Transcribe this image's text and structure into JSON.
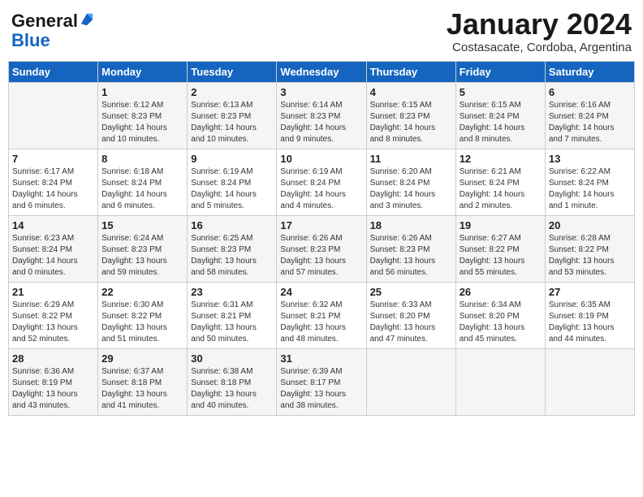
{
  "logo": {
    "general": "General",
    "blue": "Blue"
  },
  "title": "January 2024",
  "location": "Costasacate, Cordoba, Argentina",
  "days_header": [
    "Sunday",
    "Monday",
    "Tuesday",
    "Wednesday",
    "Thursday",
    "Friday",
    "Saturday"
  ],
  "weeks": [
    [
      {
        "day": "",
        "content": ""
      },
      {
        "day": "1",
        "content": "Sunrise: 6:12 AM\nSunset: 8:23 PM\nDaylight: 14 hours\nand 10 minutes."
      },
      {
        "day": "2",
        "content": "Sunrise: 6:13 AM\nSunset: 8:23 PM\nDaylight: 14 hours\nand 10 minutes."
      },
      {
        "day": "3",
        "content": "Sunrise: 6:14 AM\nSunset: 8:23 PM\nDaylight: 14 hours\nand 9 minutes."
      },
      {
        "day": "4",
        "content": "Sunrise: 6:15 AM\nSunset: 8:23 PM\nDaylight: 14 hours\nand 8 minutes."
      },
      {
        "day": "5",
        "content": "Sunrise: 6:15 AM\nSunset: 8:24 PM\nDaylight: 14 hours\nand 8 minutes."
      },
      {
        "day": "6",
        "content": "Sunrise: 6:16 AM\nSunset: 8:24 PM\nDaylight: 14 hours\nand 7 minutes."
      }
    ],
    [
      {
        "day": "7",
        "content": "Sunrise: 6:17 AM\nSunset: 8:24 PM\nDaylight: 14 hours\nand 6 minutes."
      },
      {
        "day": "8",
        "content": "Sunrise: 6:18 AM\nSunset: 8:24 PM\nDaylight: 14 hours\nand 6 minutes."
      },
      {
        "day": "9",
        "content": "Sunrise: 6:19 AM\nSunset: 8:24 PM\nDaylight: 14 hours\nand 5 minutes."
      },
      {
        "day": "10",
        "content": "Sunrise: 6:19 AM\nSunset: 8:24 PM\nDaylight: 14 hours\nand 4 minutes."
      },
      {
        "day": "11",
        "content": "Sunrise: 6:20 AM\nSunset: 8:24 PM\nDaylight: 14 hours\nand 3 minutes."
      },
      {
        "day": "12",
        "content": "Sunrise: 6:21 AM\nSunset: 8:24 PM\nDaylight: 14 hours\nand 2 minutes."
      },
      {
        "day": "13",
        "content": "Sunrise: 6:22 AM\nSunset: 8:24 PM\nDaylight: 14 hours\nand 1 minute."
      }
    ],
    [
      {
        "day": "14",
        "content": "Sunrise: 6:23 AM\nSunset: 8:24 PM\nDaylight: 14 hours\nand 0 minutes."
      },
      {
        "day": "15",
        "content": "Sunrise: 6:24 AM\nSunset: 8:23 PM\nDaylight: 13 hours\nand 59 minutes."
      },
      {
        "day": "16",
        "content": "Sunrise: 6:25 AM\nSunset: 8:23 PM\nDaylight: 13 hours\nand 58 minutes."
      },
      {
        "day": "17",
        "content": "Sunrise: 6:26 AM\nSunset: 8:23 PM\nDaylight: 13 hours\nand 57 minutes."
      },
      {
        "day": "18",
        "content": "Sunrise: 6:26 AM\nSunset: 8:23 PM\nDaylight: 13 hours\nand 56 minutes."
      },
      {
        "day": "19",
        "content": "Sunrise: 6:27 AM\nSunset: 8:22 PM\nDaylight: 13 hours\nand 55 minutes."
      },
      {
        "day": "20",
        "content": "Sunrise: 6:28 AM\nSunset: 8:22 PM\nDaylight: 13 hours\nand 53 minutes."
      }
    ],
    [
      {
        "day": "21",
        "content": "Sunrise: 6:29 AM\nSunset: 8:22 PM\nDaylight: 13 hours\nand 52 minutes."
      },
      {
        "day": "22",
        "content": "Sunrise: 6:30 AM\nSunset: 8:22 PM\nDaylight: 13 hours\nand 51 minutes."
      },
      {
        "day": "23",
        "content": "Sunrise: 6:31 AM\nSunset: 8:21 PM\nDaylight: 13 hours\nand 50 minutes."
      },
      {
        "day": "24",
        "content": "Sunrise: 6:32 AM\nSunset: 8:21 PM\nDaylight: 13 hours\nand 48 minutes."
      },
      {
        "day": "25",
        "content": "Sunrise: 6:33 AM\nSunset: 8:20 PM\nDaylight: 13 hours\nand 47 minutes."
      },
      {
        "day": "26",
        "content": "Sunrise: 6:34 AM\nSunset: 8:20 PM\nDaylight: 13 hours\nand 45 minutes."
      },
      {
        "day": "27",
        "content": "Sunrise: 6:35 AM\nSunset: 8:19 PM\nDaylight: 13 hours\nand 44 minutes."
      }
    ],
    [
      {
        "day": "28",
        "content": "Sunrise: 6:36 AM\nSunset: 8:19 PM\nDaylight: 13 hours\nand 43 minutes."
      },
      {
        "day": "29",
        "content": "Sunrise: 6:37 AM\nSunset: 8:18 PM\nDaylight: 13 hours\nand 41 minutes."
      },
      {
        "day": "30",
        "content": "Sunrise: 6:38 AM\nSunset: 8:18 PM\nDaylight: 13 hours\nand 40 minutes."
      },
      {
        "day": "31",
        "content": "Sunrise: 6:39 AM\nSunset: 8:17 PM\nDaylight: 13 hours\nand 38 minutes."
      },
      {
        "day": "",
        "content": ""
      },
      {
        "day": "",
        "content": ""
      },
      {
        "day": "",
        "content": ""
      }
    ]
  ]
}
